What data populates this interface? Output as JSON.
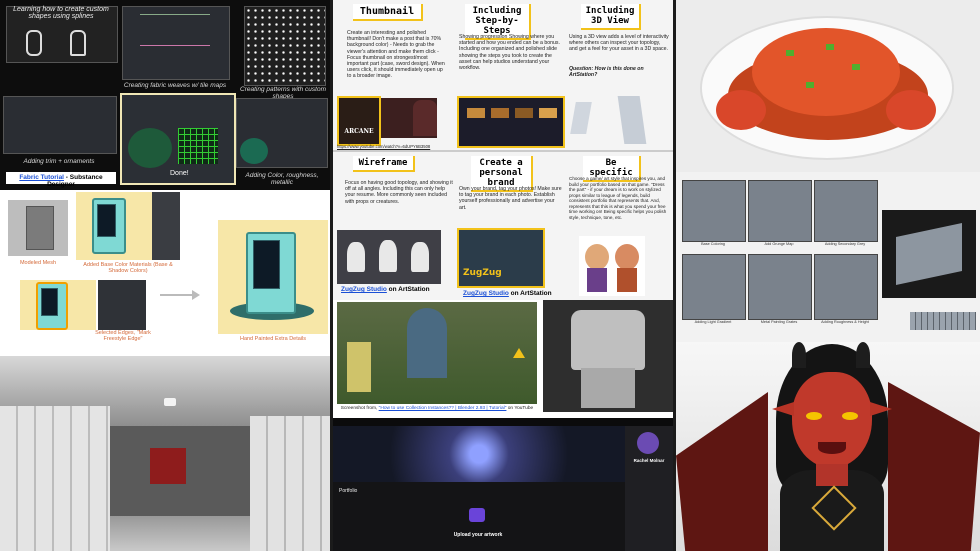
{
  "panel_a": {
    "caption_top": "Learning how to create custom shapes using splines",
    "caption_fabric": "Creating fabric weaves w/ tile maps",
    "caption_patterns": "Creating patterns with custom shapes",
    "caption_trim": "Adding trim + ornaments",
    "done_label": "Done!",
    "caption_color": "Adding Color, roughness, metallic",
    "tutorial_link": "Fabric Tutorial",
    "tutorial_suffix": " - Substance Designer"
  },
  "panel_b": {
    "label_modeled": "Modeled Mesh",
    "label_basecolor": "Added Base Color Materials (Base & Shadow Colors)",
    "label_edges": "Selected Edges, \"Mark Freestyle Edge\"",
    "label_final": "Hand Painted Extra Details"
  },
  "panel_d": {
    "thumbnail_title": "Thumbnail",
    "thumbnail_body": "Create an interesting and polished thumbnail! Don't make a post that is 70% background color) - Needs to grab the viewer's attention and make them click - Focus thumbnail on strongest/most important part (case, sword design). When users click, it should immediately open up to a broader image.",
    "steps_title": "Including Step-by-Steps",
    "steps_body": "Showing progression Showing where you started and how you ended can be a bonus. Including one organized and polished slide showing the steps you took to create the asset can help studios understand your workflow.",
    "view3d_title": "Including 3D View",
    "view3d_body": "Using a 3D view adds a level of interactivity where others can inspect your topology, and get a feel for your asset in a 3D space.",
    "view3d_question": "Question: How is this done on ArtStation?",
    "arcane_label": "ARCANE",
    "youtube_link": "https://www.youtube.com/watch?v=6dUPY6B3508",
    "wireframe_title": "Wireframe",
    "wireframe_body": "Focus on having good topology, and showing it off at all angles. Including this can only help your resume. More commonly seen included with props or creatures.",
    "brand_title": "Create a personal brand",
    "brand_body": "Own your brand, tag your photos! Make sure to tag your brand in each photo. Establish yourself professionally and advertise your art.",
    "specific_title": "Be specific",
    "specific_body": "Choose a game/ art style that inspires you, and build your portfolio based on that game. \"Dress the part\" - if your dream is to work on stylized props similar to league of legends, build consistent portfolio that represents that. And, represents that this is what you spend your free time working on! Being specific helps you polish style, technique, tone, etc.",
    "zugzug_link": "ZugZug Studio",
    "on_artstation": " on ArtStation",
    "zugzug_logo": "ZugZug"
  },
  "panel_e": {
    "caption_prefix": "Screenshot from, ",
    "caption_link": "\"How to use Collection Instances?? | Blender 2.93 | Tutorial\"",
    "caption_suffix": " on YouTube"
  },
  "panel_f": {
    "profile_name": "Rachel Molnar",
    "portfolio_label": "Portfolio",
    "upload_title": "Upload your artwork"
  },
  "panel_g": {
    "tile_captions": [
      "Base Coloring",
      "Add Grunge Map",
      "Adding Secondary Grey",
      "Adding Light Gradient",
      "Metal Painting Grates",
      "Adding Roughness & Height"
    ]
  },
  "colors": {
    "accent_yellow": "#f2c21a",
    "vending_teal": "#7fd9d4",
    "label_orange": "#d46a3a",
    "demon_red": "#c0392b"
  }
}
